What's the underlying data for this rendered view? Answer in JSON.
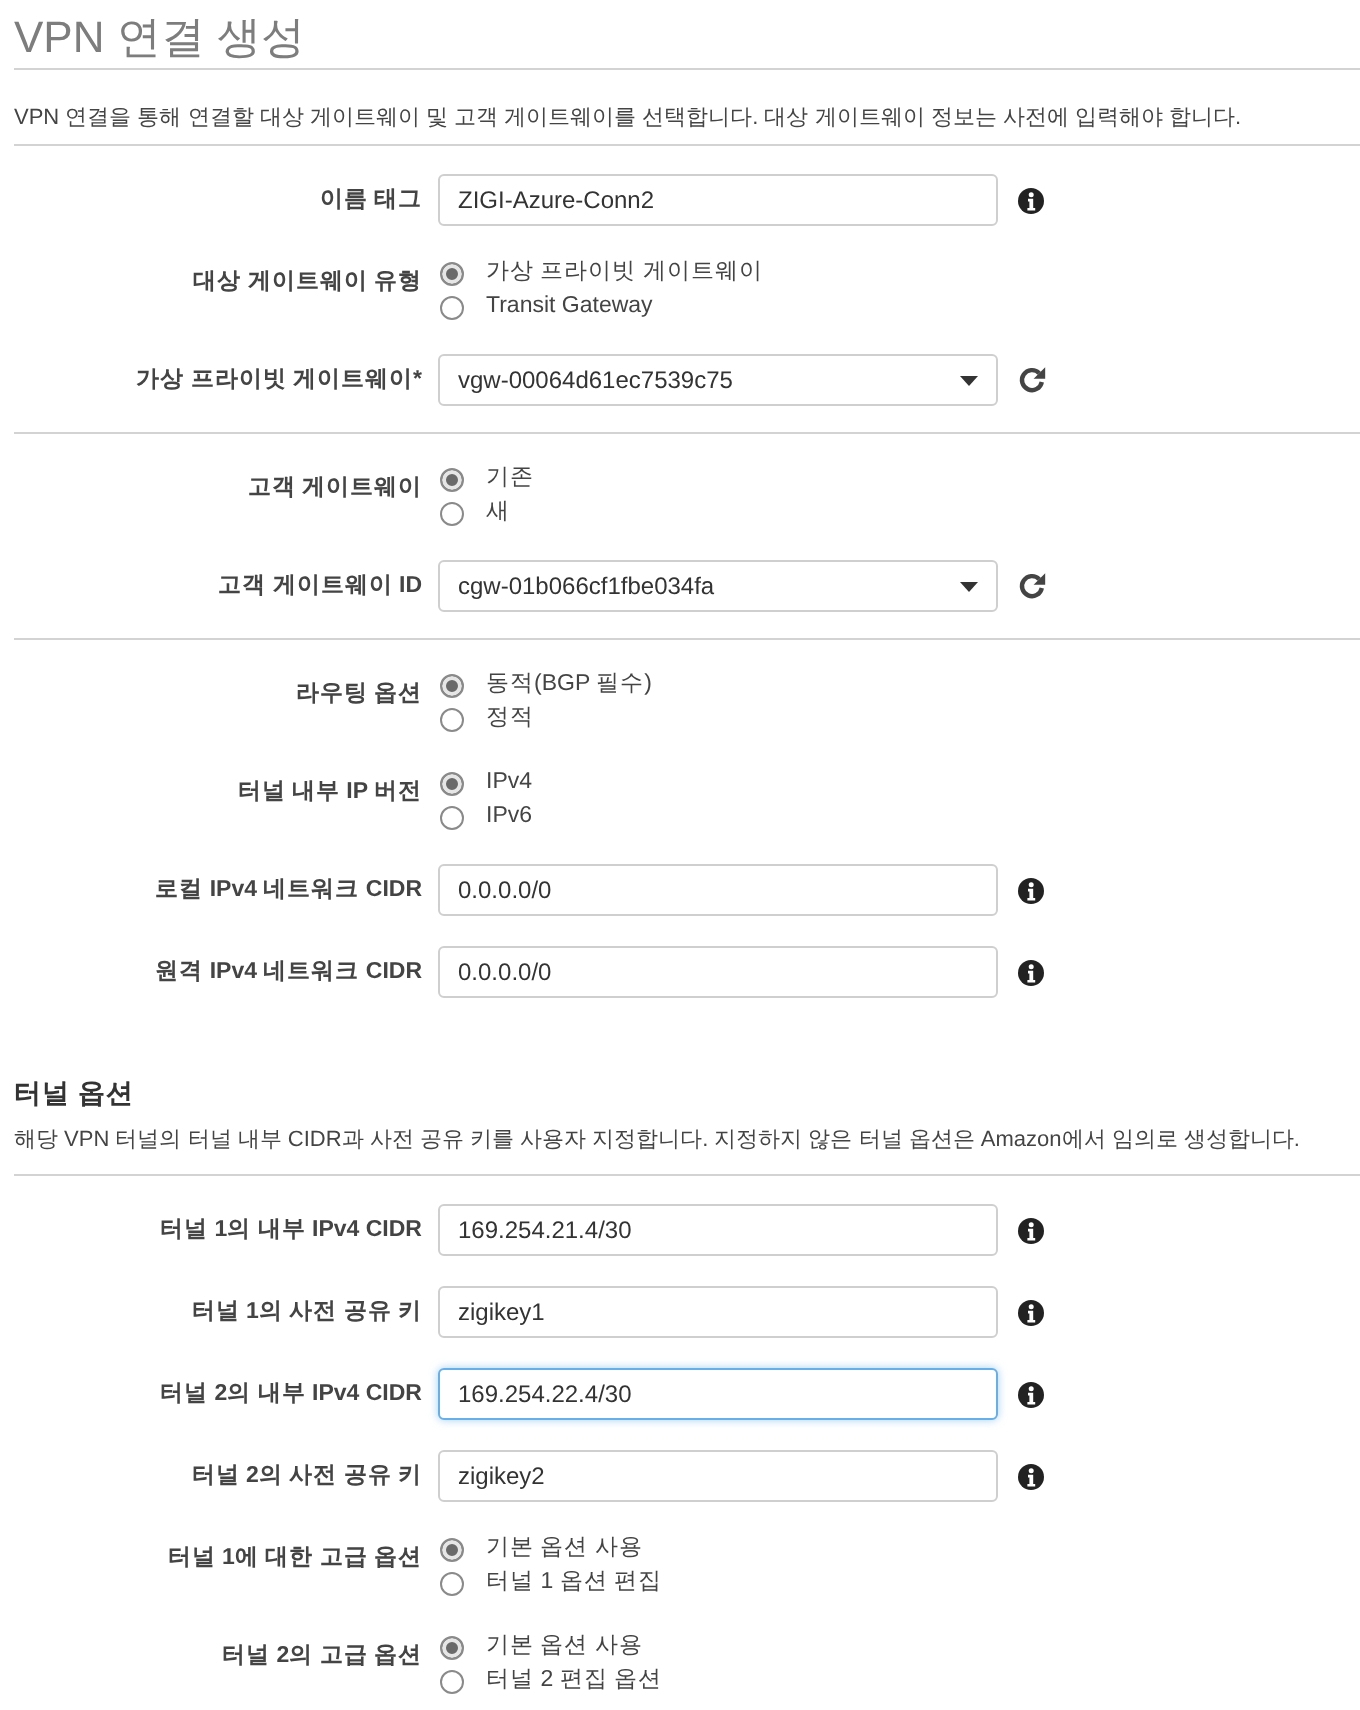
{
  "title": "VPN 연결 생성",
  "description": "VPN 연결을 통해 연결할 대상 게이트웨이 및 고객 게이트웨이를 선택합니다. 대상 게이트웨이 정보는 사전에 입력해야 합니다.",
  "sections": [
    {
      "rows": [
        {
          "kind": "text",
          "label": "이름 태그",
          "value": "ZIGI-Azure-Conn2",
          "focused": false
        },
        {
          "kind": "radio",
          "label": "대상 게이트웨이 유형",
          "options": [
            {
              "label": "가상 프라이빗 게이트웨이",
              "selected": true
            },
            {
              "label": "Transit Gateway",
              "selected": false
            }
          ]
        },
        {
          "kind": "select",
          "label": "가상 프라이빗 게이트웨이*",
          "value": "vgw-00064d61ec7539c75"
        }
      ]
    },
    {
      "rows": [
        {
          "kind": "radio",
          "label": "고객 게이트웨이",
          "options": [
            {
              "label": "기존",
              "selected": true
            },
            {
              "label": "새",
              "selected": false
            }
          ]
        },
        {
          "kind": "select",
          "label": "고객 게이트웨이 ID",
          "value": "cgw-01b066cf1fbe034fa"
        }
      ]
    },
    {
      "rows": [
        {
          "kind": "radio",
          "label": "라우팅 옵션",
          "options": [
            {
              "label": "동적(BGP 필수)",
              "selected": true
            },
            {
              "label": "정적",
              "selected": false
            }
          ]
        },
        {
          "kind": "radio",
          "label": "터널 내부 IP 버전",
          "options": [
            {
              "label": "IPv4",
              "selected": true
            },
            {
              "label": "IPv6",
              "selected": false
            }
          ]
        },
        {
          "kind": "text",
          "label": "로컬 IPv4 네트워크 CIDR",
          "value": "0.0.0.0/0",
          "focused": false
        },
        {
          "kind": "text",
          "label": "원격 IPv4 네트워크 CIDR",
          "value": "0.0.0.0/0",
          "focused": false
        }
      ]
    }
  ],
  "tunnel_options": {
    "heading": "터널 옵션",
    "description": "해당 VPN 터널의 터널 내부 CIDR과 사전 공유 키를 사용자 지정합니다. 지정하지 않은 터널 옵션은 Amazon에서 임의로 생성합니다.",
    "rows": [
      {
        "kind": "text",
        "label": "터널 1의 내부 IPv4 CIDR",
        "value": "169.254.21.4/30",
        "focused": false
      },
      {
        "kind": "text",
        "label": "터널 1의 사전 공유 키",
        "value": "zigikey1",
        "focused": false
      },
      {
        "kind": "text",
        "label": "터널 2의 내부 IPv4 CIDR",
        "value": "169.254.22.4/30",
        "focused": true
      },
      {
        "kind": "text",
        "label": "터널 2의 사전 공유 키",
        "value": "zigikey2",
        "focused": false
      },
      {
        "kind": "radio",
        "label": "터널 1에 대한 고급 옵션",
        "options": [
          {
            "label": "기본 옵션 사용",
            "selected": true
          },
          {
            "label": "터널 1 옵션 편집",
            "selected": false
          }
        ]
      },
      {
        "kind": "radio",
        "label": "터널 2의 고급 옵션",
        "options": [
          {
            "label": "기본 옵션 사용",
            "selected": true
          },
          {
            "label": "터널 2 편집 옵션",
            "selected": false
          }
        ]
      }
    ]
  }
}
